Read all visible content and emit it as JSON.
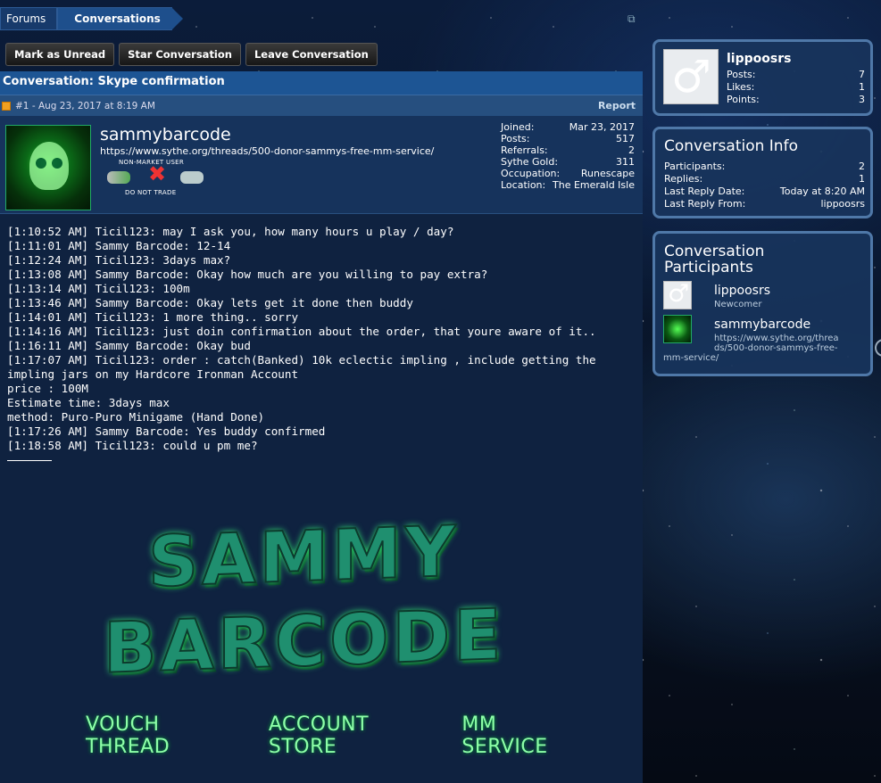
{
  "breadcrumb": {
    "items": [
      "Forums",
      "Conversations"
    ]
  },
  "toolbar": {
    "mark_unread": "Mark as Unread",
    "star": "Star Conversation",
    "leave": "Leave Conversation"
  },
  "conversation": {
    "title": "Conversation: Skype confirmation"
  },
  "message": {
    "meta": "#1 - Aug 23, 2017 at 8:19 AM",
    "report": "Report",
    "author": {
      "name": "sammybarcode",
      "url": "https://www.sythe.org/threads/500-donor-sammys-free-mm-service/",
      "badge_top": "NON-MARKET USER",
      "badge_bottom": "DO NOT TRADE",
      "stats": [
        {
          "label": "Joined:",
          "value": "Mar 23, 2017"
        },
        {
          "label": "Posts:",
          "value": "517"
        },
        {
          "label": "Referrals:",
          "value": "2"
        },
        {
          "label": "Sythe Gold:",
          "value": "311"
        },
        {
          "label": "Occupation:",
          "value": "Runescape"
        },
        {
          "label": "Location:",
          "value": "The Emerald Isle"
        }
      ]
    },
    "lines": [
      "[1:10:52 AM] Ticil123: may I ask you, how many hours u play / day?",
      "[1:11:01 AM] Sammy Barcode: 12-14",
      "[1:12:24 AM] Ticil123: 3days max?",
      "[1:13:08 AM] Sammy Barcode: Okay how much are you willing to pay extra?",
      "[1:13:14 AM] Ticil123: 100m",
      "[1:13:46 AM] Sammy Barcode: Okay lets get it done then buddy",
      "[1:14:01 AM] Ticil123: 1 more thing.. sorry",
      "[1:14:16 AM] Ticil123: just doin confirmation about the order, that youre aware of it..",
      "[1:16:11 AM] Sammy Barcode: Okay bud",
      "[1:17:07 AM] Ticil123: order : catch(Banked) 10k eclectic impling , include getting the impling jars on my Hardcore Ironman Account",
      "price : 100M",
      "Estimate time: 3days max",
      "method: Puro-Puro Minigame (Hand Done)",
      "[1:17:26 AM] Sammy Barcode: Yes buddy confirmed",
      "[1:18:58 AM] Ticil123: could u pm me?"
    ],
    "signature": {
      "line1": "SAMMY",
      "line2": "BARCODE",
      "links": [
        "VOUCH THREAD",
        "ACCOUNT STORE",
        "MM SERVICE"
      ]
    }
  },
  "sidebar": {
    "user": {
      "name": "lippoosrs",
      "stats": [
        {
          "label": "Posts:",
          "value": "7"
        },
        {
          "label": "Likes:",
          "value": "1"
        },
        {
          "label": "Points:",
          "value": "3"
        }
      ]
    },
    "info": {
      "title": "Conversation Info",
      "rows": [
        {
          "label": "Participants:",
          "value": "2"
        },
        {
          "label": "Replies:",
          "value": "1"
        },
        {
          "label": "Last Reply Date:",
          "value": "Today at 8:20 AM"
        },
        {
          "label": "Last Reply From:",
          "value": "lippoosrs"
        }
      ]
    },
    "participants": {
      "title_line1": "Conversation",
      "title_line2": "Participants",
      "list": [
        {
          "name": "lippoosrs",
          "subtitle": "Newcomer"
        },
        {
          "name": "sammybarcode",
          "url_line1": "https://www.sythe.org/threa",
          "url_line2": "ds/500-donor-sammys-free-",
          "url_line3": "mm-service/"
        }
      ]
    }
  },
  "colors": {
    "accent": "#1d5594",
    "panel": "#16335c",
    "sidebar_border": "#4f78a8",
    "signature_green": "#8dffa8"
  }
}
